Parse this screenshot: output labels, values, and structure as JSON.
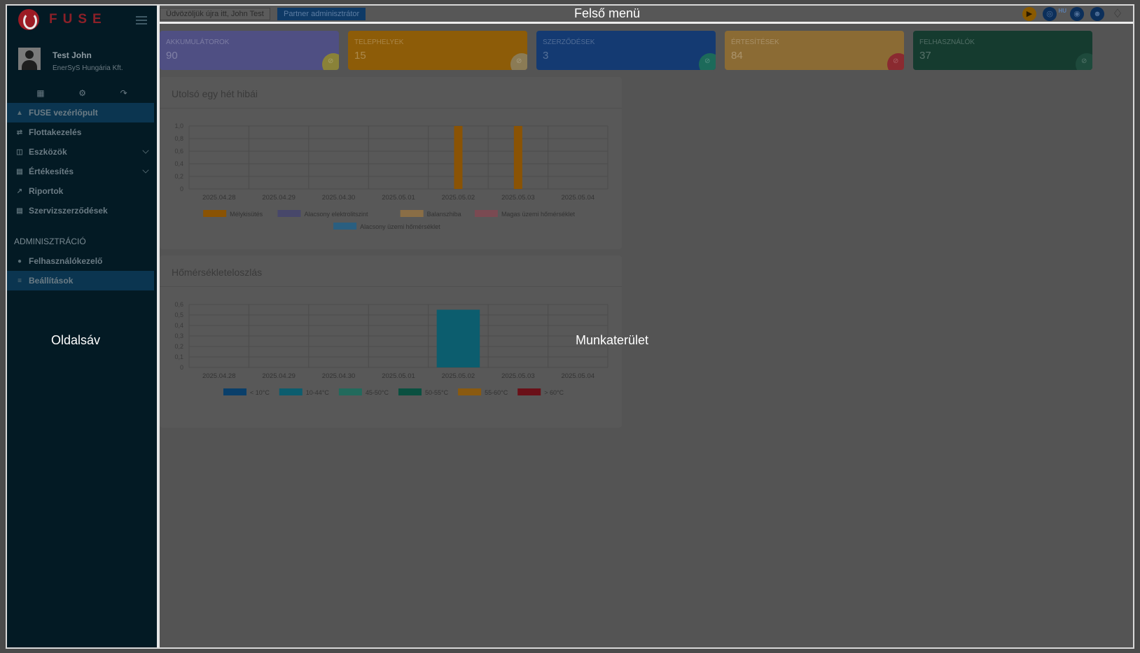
{
  "app": {
    "logo_text": "FUSE",
    "user_name": "Test John",
    "user_company": "EnerSyS Hungária Kft.",
    "annotations": {
      "top_menu": "Felső menü",
      "sidebar": "Oldalsáv",
      "workspace": "Munkaterület"
    }
  },
  "topbar": {
    "welcome": "Üdvözöljük újra itt, John Test",
    "role": "Partner adminisztrátor",
    "language_badge": "HU",
    "icons": [
      "play-icon",
      "globe-icon",
      "palette-icon",
      "user-circle-icon",
      "bell-icon"
    ]
  },
  "sidebar": {
    "quick_icons": [
      "calendar-icon",
      "gear-icon",
      "logout-icon"
    ],
    "items": [
      {
        "label": "FUSE vezérlőpult",
        "icon": "dashboard-icon",
        "active": true
      },
      {
        "label": "Flottakezelés",
        "icon": "arrows-icon"
      },
      {
        "label": "Eszközök",
        "icon": "device-icon",
        "expandable": true
      },
      {
        "label": "Értékesítés",
        "icon": "sales-icon",
        "expandable": true
      },
      {
        "label": "Riportok",
        "icon": "chart-line-icon"
      },
      {
        "label": "Szervizszerződések",
        "icon": "contract-icon"
      }
    ],
    "admin_section": "ADMINISZTRÁCIÓ",
    "admin_items": [
      {
        "label": "Felhasználókezelő",
        "icon": "users-icon"
      },
      {
        "label": "Beállítások",
        "icon": "sliders-icon",
        "active": true
      }
    ]
  },
  "cards": [
    {
      "label": "AKKUMULÁTOROK",
      "value": "90",
      "color": "#4f4f83",
      "dot": "#8a8238"
    },
    {
      "label": "TELEPHELYEK",
      "value": "15",
      "color": "#8d5c08",
      "dot": "#8b7b55"
    },
    {
      "label": "SZERZŐDÉSEK",
      "value": "3",
      "color": "#143a72",
      "dot": "#1c6a5a"
    },
    {
      "label": "ÉRTESÍTÉSEK",
      "value": "84",
      "color": "#8b6b34",
      "dot": "#8a2a30"
    },
    {
      "label": "FELHASZNÁLÓK",
      "value": "37",
      "color": "#153b2f",
      "dot": "#1e4a3c"
    }
  ],
  "chart_data": [
    {
      "type": "bar",
      "title": "Utolsó egy hét hibái",
      "categories": [
        "2025.04.28",
        "2025.04.29",
        "2025.04.30",
        "2025.05.01",
        "2025.05.02",
        "2025.05.03",
        "2025.05.04"
      ],
      "yticks": [
        "0",
        "0,2",
        "0,4",
        "0,6",
        "0,8",
        "1,0"
      ],
      "ylim": [
        0,
        1
      ],
      "series": [
        {
          "name": "Mélykisütés",
          "color": "#8a5304",
          "values": [
            0,
            0,
            0,
            0,
            1,
            1,
            0
          ]
        },
        {
          "name": "Alacsony elektrolitszint",
          "color": "#47476a",
          "values": [
            0,
            0,
            0,
            0,
            0,
            0,
            0
          ]
        },
        {
          "name": "Balanszhiba",
          "color": "#8a6e46",
          "values": [
            0,
            0,
            0,
            0,
            0,
            0,
            0
          ]
        },
        {
          "name": "Magas üzemi hőmérséklet",
          "color": "#7a4a52",
          "values": [
            0,
            0,
            0,
            0,
            0,
            0,
            0
          ]
        },
        {
          "name": "Alacsony üzemi hőmérséklet",
          "color": "#2a5f80",
          "values": [
            0,
            0,
            0,
            0,
            0,
            0,
            0
          ]
        }
      ]
    },
    {
      "type": "bar",
      "title": "Hőmérsékleteloszlás",
      "categories": [
        "2025.04.28",
        "2025.04.29",
        "2025.04.30",
        "2025.05.01",
        "2025.05.02",
        "2025.05.03",
        "2025.05.04"
      ],
      "yticks": [
        "0",
        "0,1",
        "0,2",
        "0,3",
        "0,4",
        "0,5",
        "0,6"
      ],
      "ylim": [
        0,
        0.6
      ],
      "series": [
        {
          "name": "< 10°C",
          "color": "#0a3f6a",
          "values": [
            0,
            0,
            0,
            0,
            0,
            0,
            0
          ]
        },
        {
          "name": "10-44°C",
          "color": "#0c5d6e",
          "values": [
            0,
            0,
            0,
            0,
            0.55,
            0,
            0
          ]
        },
        {
          "name": "45-50°C",
          "color": "#226a5c",
          "values": [
            0,
            0,
            0,
            0,
            0,
            0,
            0
          ]
        },
        {
          "name": "50-55°C",
          "color": "#0a5040",
          "values": [
            0,
            0,
            0,
            0,
            0,
            0,
            0
          ]
        },
        {
          "name": "55-60°C",
          "color": "#8a5a10",
          "values": [
            0,
            0,
            0,
            0,
            0,
            0,
            0
          ]
        },
        {
          "name": "> 60°C",
          "color": "#6a1018",
          "values": [
            0,
            0,
            0,
            0,
            0,
            0,
            0
          ]
        }
      ]
    }
  ]
}
